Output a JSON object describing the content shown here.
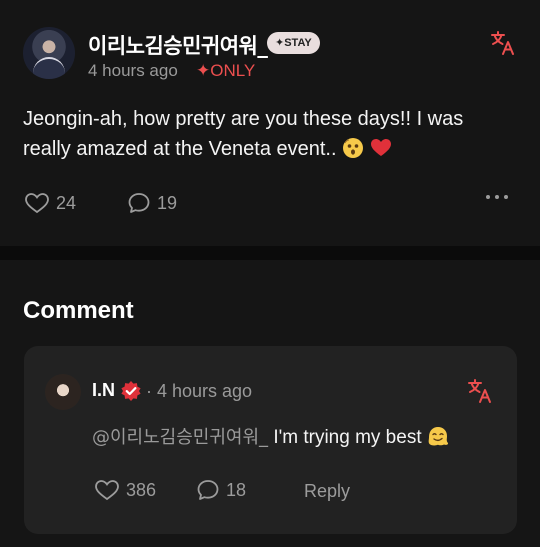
{
  "post": {
    "author": "이리노김승민귀여워_",
    "badge": "✦STAY",
    "time": "4 hours ago",
    "audience": "✦ONLY",
    "body_line1": "Jeongin-ah, how pretty are you these days!! I was",
    "body_line2": "really amazed at the Veneta event..",
    "likes": "24",
    "comments": "19"
  },
  "section_title": "Comment",
  "comment": {
    "author": "I.N",
    "time": "· 4 hours ago",
    "mention": "@이리노김승민귀여워_",
    "text": "I'm trying my best",
    "likes": "386",
    "replies": "18",
    "reply_label": "Reply"
  },
  "colors": {
    "background": "#151515",
    "card": "#222222",
    "accent_red": "#ec4f4f",
    "muted": "#9c9c9c"
  },
  "icons": [
    "translate-icon",
    "heart-icon",
    "comment-bubble-icon",
    "more-icon",
    "verified-badge-icon",
    "astonished-emoji-icon",
    "red-heart-emoji-icon",
    "melting-face-emoji-icon"
  ]
}
